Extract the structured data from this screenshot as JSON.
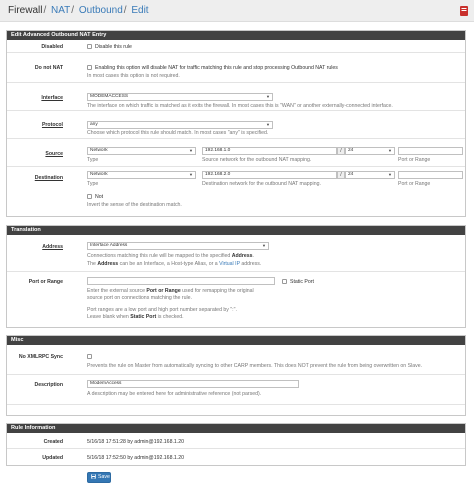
{
  "breadcrumb": {
    "item1": "Firewall",
    "item2": "NAT",
    "item3": "Outbound",
    "item4": "Edit",
    "sep": "/"
  },
  "panels": {
    "edit": "Edit Advanced Outbound NAT Entry",
    "translation": "Translation",
    "misc": "Misc",
    "info": "Rule Information"
  },
  "disabled": {
    "label": "Disabled",
    "option": "Disable this rule"
  },
  "donotnat": {
    "label": "Do not NAT",
    "option": "Enabling this option will disable NAT for traffic matching this rule and stop processing Outbound NAT rules",
    "hint": "In most cases this option is not required."
  },
  "interface": {
    "label": "Interface",
    "value": "MODEMACCESS",
    "hint": "The interface on which traffic is matched as it exits the firewall. In most cases this is \"WAN\" or another externally-connected interface."
  },
  "protocol": {
    "label": "Protocol",
    "value": "any",
    "hint": "Choose which protocol this rule should match. In most cases \"any\" is specified."
  },
  "source": {
    "label": "Source",
    "type": "Network",
    "type_hint": "Type",
    "address": "192.168.1.0",
    "addr_hint": "Source network for the outbound NAT mapping.",
    "sep": "/",
    "mask": "24",
    "port_hint": "Port or Range"
  },
  "destination": {
    "label": "Destination",
    "type": "Network",
    "type_hint": "Type",
    "address": "192.168.2.0",
    "addr_hint": "Destination network for the outbound NAT mapping.",
    "sep": "/",
    "mask": "24",
    "port_hint": "Port or Range",
    "not_label": "Not",
    "not_hint": "Invert the sense of the destination match."
  },
  "address": {
    "label": "Address",
    "value": "Interface Address",
    "hint1": "Connections matching this rule will be mapped to the specified ",
    "hint1_b": "Address",
    "hint1_end": ".",
    "hint2_a": "The ",
    "hint2_b": "Address",
    "hint2_c": " can be an Interface, a Host-type Alias, or a ",
    "hint2_link": "Virtual IP",
    "hint2_end": " address."
  },
  "port": {
    "label": "Port or Range",
    "static": "Static Port",
    "hint1_a": "Enter the external source ",
    "hint1_b": "Port or Range",
    "hint1_c": " used for remapping the original",
    "hint2": "source port on connections matching the rule.",
    "hint3": "Port ranges are a low port and high port number separated by \":\".",
    "hint4_a": "Leave blank when ",
    "hint4_b": "Static Port",
    "hint4_c": " is checked."
  },
  "xmlrpc": {
    "label": "No XMLRPC Sync",
    "hint": "Prevents the rule on Master from automatically syncing to other CARP members. This does NOT prevent the rule from being overwritten on Slave."
  },
  "description": {
    "label": "Description",
    "value": "ModemAccess",
    "hint": "A description may be entered here for administrative reference (not parsed)."
  },
  "created": {
    "label": "Created",
    "value": "5/16/18 17:51:28 by admin@192.168.1.20"
  },
  "updated": {
    "label": "Updated",
    "value": "5/16/18 17:52:50 by admin@192.168.1.20"
  },
  "save": "Save"
}
